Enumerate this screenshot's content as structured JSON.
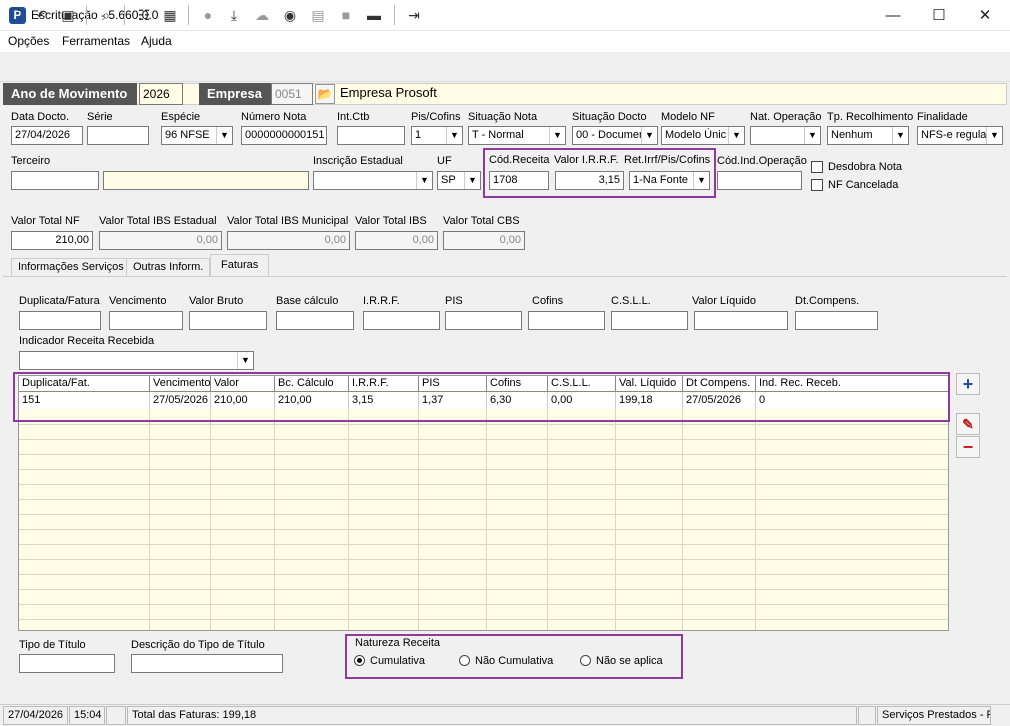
{
  "window": {
    "title": "Escrituração - 5.660.0.0",
    "min": "—",
    "max": "☐",
    "close": "✕"
  },
  "menu": [
    "Opções",
    "Ferramentas",
    "Ajuda"
  ],
  "header": {
    "ano_label": "Ano de Movimento",
    "ano_value": "2026",
    "empresa_label": "Empresa",
    "empresa_code": "0051",
    "empresa_name": "Empresa Prosoft"
  },
  "row1": {
    "data_label": "Data Docto.",
    "data_value": "27/04/2026",
    "serie_label": "Série",
    "serie_value": "",
    "especie_label": "Espécie",
    "especie_value": "96 NFSE",
    "numero_label": "Número Nota",
    "numero_value": "0000000000151",
    "intctb_label": "Int.Ctb",
    "intctb_value": "",
    "pis_label": "Pis/Cofins",
    "pis_value": "1",
    "situacao_label": "Situação Nota",
    "situacao_value": "T - Normal",
    "sitdocto_label": "Situação Docto",
    "sitdocto_value": "00 - Documer",
    "modelo_label": "Modelo NF",
    "modelo_value": "Modelo Únic",
    "natop_label": "Nat. Operação",
    "natop_value": "",
    "tprec_label": "Tp. Recolhimento",
    "tprec_value": "Nenhum",
    "final_label": "Finalidade",
    "final_value": "NFS-e regula"
  },
  "row2": {
    "terceiro_label": "Terceiro",
    "ie_label": "Inscrição Estadual",
    "uf_label": "UF",
    "uf_value": "SP",
    "codrec_label": "Cód.Receita",
    "codrec_value": "1708",
    "irrf_label": "Valor I.R.R.F.",
    "irrf_value": "3,15",
    "ret_label": "Ret.Irrf/Pis/Cofins",
    "ret_value": "1-Na Fonte",
    "codind_label": "Cód.Ind.Operação",
    "desdobra_label": "Desdobra Nota",
    "cancel_label": "NF Cancelada"
  },
  "totals": [
    {
      "label": "Valor Total NF",
      "value": "210,00"
    },
    {
      "label": "Valor Total IBS Estadual",
      "value": "0,00"
    },
    {
      "label": "Valor Total IBS Municipal",
      "value": "0,00"
    },
    {
      "label": "Valor Total IBS",
      "value": "0,00"
    },
    {
      "label": "Valor Total CBS",
      "value": "0,00"
    }
  ],
  "tabs": [
    "Informações Serviços",
    "Outras Inform.",
    "Faturas"
  ],
  "fatura_fields": [
    "Duplicata/Fatura",
    "Vencimento",
    "Valor Bruto",
    "Base cálculo",
    "I.R.R.F.",
    "PIS",
    "Cofins",
    "C.S.L.L.",
    "Valor Líquido",
    "Dt.Compens."
  ],
  "indicador_label": "Indicador Receita Recebida",
  "grid": {
    "headers": [
      "Duplicata/Fat.",
      "Vencimento",
      "Valor",
      "Bc. Cálculo",
      "I.R.R.F.",
      "PIS",
      "Cofins",
      "C.S.L.L.",
      "Val. Líquido",
      "Dt Compens.",
      "Ind. Rec. Receb."
    ],
    "row": [
      "151",
      "27/05/2026",
      "210,00",
      "210,00",
      "3,15",
      "1,37",
      "6,30",
      "0,00",
      "199,18",
      "27/05/2026",
      "0"
    ]
  },
  "bottom": {
    "tipo_label": "Tipo de Título",
    "desc_label": "Descrição do Tipo de Título",
    "natureza_label": "Natureza Receita",
    "radio": [
      "Cumulativa",
      "Não Cumulativa",
      "Não se aplica"
    ]
  },
  "status": {
    "date": "27/04/2026",
    "time": "15:04",
    "total": "Total das Faturas: 199,18",
    "mode": "Serviços Prestados - P"
  }
}
